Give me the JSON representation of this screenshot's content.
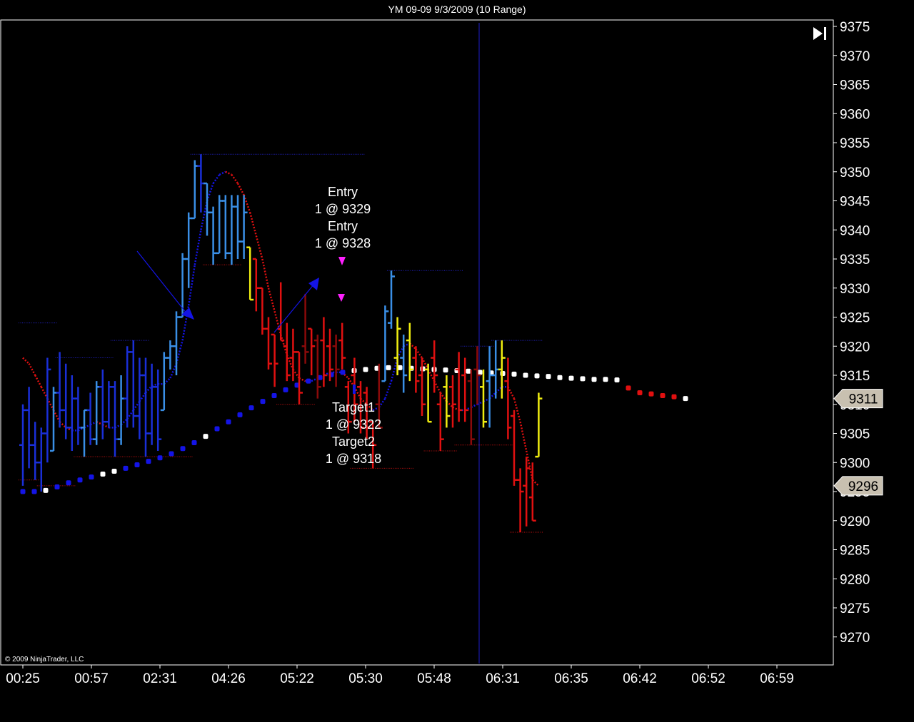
{
  "window": {
    "title": "YM 09-09  9/3/2009 (10 Range)"
  },
  "copyright": "© 2009 NinjaTrader, LLC",
  "colors": {
    "background": "#000000",
    "axis": "#ffffff",
    "bar_up": "#3a8fe6",
    "bar_up_dark": "#1a2fd8",
    "bar_down": "#e01010",
    "bar_down_dark": "#8a0a0a",
    "bar_neutral": "#f0ee10",
    "ma_up": "#1414e6",
    "ma_down": "#e01010",
    "trend_bull": "#1414e6",
    "trend_neutral": "#ffffff",
    "trend_bear": "#e01010",
    "level_high": "#2020c0",
    "level_low": "#c01010",
    "marker": "#ff20ff",
    "cursor_line": "#1c1cc8",
    "price_label": "#c8c0b0"
  },
  "controls": {
    "scroll_end_icon": "skip-to-end-icon"
  },
  "chart_data": {
    "type": "ohlc",
    "y_ticks": [
      9375,
      9370,
      9365,
      9360,
      9355,
      9350,
      9345,
      9340,
      9335,
      9330,
      9325,
      9320,
      9315,
      9310,
      9305,
      9300,
      9295,
      9290,
      9285,
      9280,
      9275,
      9270
    ],
    "ylim": [
      9265,
      9376
    ],
    "x_ticks": [
      "00:25",
      "00:57",
      "02:31",
      "04:26",
      "05:22",
      "05:30",
      "05:48",
      "06:31",
      "06:35",
      "06:42",
      "06:52",
      "06:59"
    ],
    "price_labels": [
      9311,
      9296
    ],
    "annotations": [
      {
        "label": "Entry",
        "value": "1 @ 9329"
      },
      {
        "label": "Entry",
        "value": "1 @ 9328"
      },
      {
        "label": "Target1",
        "value": "1 @ 9322"
      },
      {
        "label": "Target2",
        "value": "1 @ 9318"
      }
    ],
    "bars": [
      {
        "o": 9303,
        "h": 9310,
        "l": 9296,
        "c": 9309,
        "k": "ud"
      },
      {
        "o": 9309,
        "h": 9313,
        "l": 9299,
        "c": 9303,
        "k": "ud"
      },
      {
        "o": 9303,
        "h": 9307,
        "l": 9297,
        "c": 9300,
        "k": "ud"
      },
      {
        "o": 9300,
        "h": 9306,
        "l": 9295,
        "c": 9305,
        "k": "ud"
      },
      {
        "o": 9305,
        "h": 9318,
        "l": 9300,
        "c": 9316,
        "k": "ud"
      },
      {
        "o": 9302,
        "h": 9313,
        "l": 9302,
        "c": 9312,
        "k": "u"
      },
      {
        "o": 9312,
        "h": 9319,
        "l": 9306,
        "c": 9309,
        "k": "ud"
      },
      {
        "o": 9309,
        "h": 9317,
        "l": 9304,
        "c": 9306,
        "k": "ud"
      },
      {
        "o": 9306,
        "h": 9315,
        "l": 9302,
        "c": 9311,
        "k": "ud"
      },
      {
        "o": 9311,
        "h": 9313,
        "l": 9303,
        "c": 9306,
        "k": "ud"
      },
      {
        "o": 9306,
        "h": 9309,
        "l": 9301,
        "c": 9309,
        "k": "u"
      },
      {
        "o": 9309,
        "h": 9312,
        "l": 9303,
        "c": 9304,
        "k": "ud"
      },
      {
        "o": 9304,
        "h": 9314,
        "l": 9303,
        "c": 9313,
        "k": "u"
      },
      {
        "o": 9313,
        "h": 9316,
        "l": 9304,
        "c": 9307,
        "k": "ud"
      },
      {
        "o": 9307,
        "h": 9314,
        "l": 9306,
        "c": 9313,
        "k": "ud"
      },
      {
        "o": 9313,
        "h": 9314,
        "l": 9301,
        "c": 9304,
        "k": "ud"
      },
      {
        "o": 9304,
        "h": 9315,
        "l": 9303,
        "c": 9311,
        "k": "u"
      },
      {
        "o": 9311,
        "h": 9320,
        "l": 9306,
        "c": 9319,
        "k": "ud"
      },
      {
        "o": 9319,
        "h": 9321,
        "l": 9306,
        "c": 9308,
        "k": "ud"
      },
      {
        "o": 9308,
        "h": 9318,
        "l": 9304,
        "c": 9315,
        "k": "ud"
      },
      {
        "o": 9315,
        "h": 9318,
        "l": 9301,
        "c": 9305,
        "k": "ud"
      },
      {
        "o": 9305,
        "h": 9317,
        "l": 9303,
        "c": 9313,
        "k": "ud"
      },
      {
        "o": 9313,
        "h": 9316,
        "l": 9302,
        "c": 9304,
        "k": "ud"
      },
      {
        "o": 9309,
        "h": 9319,
        "l": 9309,
        "c": 9318,
        "k": "u"
      },
      {
        "o": 9318,
        "h": 9321,
        "l": 9316,
        "c": 9320,
        "k": "u"
      },
      {
        "o": 9320,
        "h": 9326,
        "l": 9315,
        "c": 9325,
        "k": "u"
      },
      {
        "o": 9325,
        "h": 9336,
        "l": 9325,
        "c": 9335,
        "k": "u"
      },
      {
        "o": 9335,
        "h": 9343,
        "l": 9330,
        "c": 9342,
        "k": "u"
      },
      {
        "o": 9342,
        "h": 9352,
        "l": 9342,
        "c": 9351,
        "k": "u"
      },
      {
        "o": 9351,
        "h": 9353,
        "l": 9343,
        "c": 9348,
        "k": "ud"
      },
      {
        "o": 9348,
        "h": 9348,
        "l": 9339,
        "c": 9343,
        "k": "u"
      },
      {
        "o": 9343,
        "h": 9344,
        "l": 9334,
        "c": 9336,
        "k": "u"
      },
      {
        "o": 9336,
        "h": 9346,
        "l": 9336,
        "c": 9345,
        "k": "u"
      },
      {
        "o": 9345,
        "h": 9346,
        "l": 9335,
        "c": 9336,
        "k": "u"
      },
      {
        "o": 9336,
        "h": 9346,
        "l": 9334,
        "c": 9344,
        "k": "u"
      },
      {
        "o": 9344,
        "h": 9346,
        "l": 9335,
        "c": 9338,
        "k": "u"
      },
      {
        "o": 9338,
        "h": 9346,
        "l": 9335,
        "c": 9343,
        "k": "u"
      },
      {
        "o": 9337,
        "h": 9337,
        "l": 9328,
        "c": 9328,
        "k": "n"
      },
      {
        "o": 9335,
        "h": 9335,
        "l": 9326,
        "c": 9330,
        "k": "d"
      },
      {
        "o": 9330,
        "h": 9330,
        "l": 9322,
        "c": 9323,
        "k": "d"
      },
      {
        "o": 9323,
        "h": 9325,
        "l": 9316,
        "c": 9317,
        "k": "d"
      },
      {
        "o": 9322,
        "h": 9322,
        "l": 9313,
        "c": 9317,
        "k": "d"
      },
      {
        "o": 9323,
        "h": 9331,
        "l": 9321,
        "c": 9321,
        "k": "d"
      },
      {
        "o": 9320,
        "h": 9324,
        "l": 9314,
        "c": 9315,
        "k": "d"
      },
      {
        "o": 9318,
        "h": 9323,
        "l": 9314,
        "c": 9319,
        "k": "d"
      },
      {
        "o": 9319,
        "h": 9319,
        "l": 9310,
        "c": 9312,
        "k": "d"
      },
      {
        "o": 9320,
        "h": 9329,
        "l": 9317,
        "c": 9319,
        "k": "dd"
      },
      {
        "o": 9323,
        "h": 9323,
        "l": 9315,
        "c": 9320,
        "k": "d"
      },
      {
        "o": 9321,
        "h": 9322,
        "l": 9311,
        "c": 9313,
        "k": "dd"
      },
      {
        "o": 9321,
        "h": 9325,
        "l": 9313,
        "c": 9315,
        "k": "d"
      },
      {
        "o": 9320,
        "h": 9323,
        "l": 9314,
        "c": 9316,
        "k": "d"
      },
      {
        "o": 9320,
        "h": 9322,
        "l": 9313,
        "c": 9316,
        "k": "dd"
      },
      {
        "o": 9321,
        "h": 9324,
        "l": 9316,
        "c": 9318,
        "k": "d"
      },
      {
        "o": 9313,
        "h": 9314,
        "l": 9305,
        "c": 9307,
        "k": "d"
      },
      {
        "o": 9315,
        "h": 9318,
        "l": 9307,
        "c": 9310,
        "k": "d"
      },
      {
        "o": 9313,
        "h": 9314,
        "l": 9305,
        "c": 9306,
        "k": "d"
      },
      {
        "o": 9312,
        "h": 9313,
        "l": 9304,
        "c": 9306,
        "k": "d"
      },
      {
        "o": 9307,
        "h": 9307,
        "l": 9299,
        "c": 9303,
        "k": "d"
      },
      {
        "o": 9310,
        "h": 9317,
        "l": 9306,
        "c": 9306,
        "k": "dd"
      },
      {
        "o": 9314,
        "h": 9327,
        "l": 9314,
        "c": 9326,
        "k": "u"
      },
      {
        "o": 9324,
        "h": 9333,
        "l": 9323,
        "c": 9332,
        "k": "u"
      },
      {
        "o": 9318,
        "h": 9325,
        "l": 9315,
        "c": 9323,
        "k": "n"
      },
      {
        "o": 9318,
        "h": 9322,
        "l": 9312,
        "c": 9315,
        "k": "u"
      },
      {
        "o": 9321,
        "h": 9324,
        "l": 9314,
        "c": 9316,
        "k": "n"
      },
      {
        "o": 9318,
        "h": 9320,
        "l": 9312,
        "c": 9314,
        "k": "d"
      },
      {
        "o": 9315,
        "h": 9318,
        "l": 9308,
        "c": 9310,
        "k": "d"
      },
      {
        "o": 9316,
        "h": 9317,
        "l": 9307,
        "c": 9307,
        "k": "n"
      },
      {
        "o": 9318,
        "h": 9321,
        "l": 9312,
        "c": 9315,
        "k": "d"
      },
      {
        "o": 9310,
        "h": 9312,
        "l": 9302,
        "c": 9304,
        "k": "d"
      },
      {
        "o": 9313,
        "h": 9315,
        "l": 9306,
        "c": 9308,
        "k": "n"
      },
      {
        "o": 9313,
        "h": 9315,
        "l": 9306,
        "c": 9310,
        "k": "d"
      },
      {
        "o": 9316,
        "h": 9319,
        "l": 9307,
        "c": 9309,
        "k": "d"
      },
      {
        "o": 9315,
        "h": 9318,
        "l": 9307,
        "c": 9309,
        "k": "d"
      },
      {
        "o": 9314,
        "h": 9316,
        "l": 9303,
        "c": 9304,
        "k": "dd"
      },
      {
        "o": 9316,
        "h": 9320,
        "l": 9310,
        "c": 9315,
        "k": "dd"
      },
      {
        "o": 9313,
        "h": 9316,
        "l": 9306,
        "c": 9307,
        "k": "n"
      },
      {
        "o": 9314,
        "h": 9320,
        "l": 9306,
        "c": 9315,
        "k": "u"
      },
      {
        "o": 9315,
        "h": 9321,
        "l": 9311,
        "c": 9316,
        "k": "u"
      },
      {
        "o": 9316,
        "h": 9321,
        "l": 9311,
        "c": 9318,
        "k": "n"
      },
      {
        "o": 9314,
        "h": 9318,
        "l": 9304,
        "c": 9306,
        "k": "d"
      },
      {
        "o": 9308,
        "h": 9309,
        "l": 9296,
        "c": 9297,
        "k": "d"
      },
      {
        "o": 9297,
        "h": 9299,
        "l": 9288,
        "c": 9295,
        "k": "d"
      },
      {
        "o": 9296,
        "h": 9301,
        "l": 9289,
        "c": 9299,
        "k": "d"
      },
      {
        "o": 9294,
        "h": 9300,
        "l": 9290,
        "c": 9290,
        "k": "d"
      },
      {
        "o": 9301,
        "h": 9312,
        "l": 9301,
        "c": 9311,
        "k": "n"
      }
    ],
    "ma": [
      9318,
      9317,
      9315,
      9313,
      9311,
      9309,
      9307,
      9306,
      9305.5,
      9305.5,
      9306,
      9306.5,
      9307,
      9306.5,
      9306,
      9306,
      9306.5,
      9307.5,
      9309,
      9310.5,
      9312,
      9313.2,
      9313.5,
      9313.5,
      9314.5,
      9317,
      9321,
      9327,
      9334,
      9340,
      9345,
      9348,
      9349.5,
      9350,
      9349.5,
      9348,
      9346,
      9343,
      9339,
      9335,
      9330,
      9326,
      9322,
      9318.5,
      9316,
      9314.5,
      9314,
      9314,
      9314.5,
      9315,
      9315.5,
      9315.5,
      9315.5,
      9314.5,
      9313,
      9311,
      9310,
      9309,
      9309.5,
      9311,
      9314,
      9318,
      9320,
      9320.5,
      9319.5,
      9318,
      9316,
      9314,
      9312,
      9310.5,
      9309.5,
      9309,
      9309,
      9309.5,
      9310,
      9310.5,
      9311,
      9312,
      9313,
      9313,
      9311,
      9307,
      9302,
      9297,
      9296
    ],
    "trend": [
      9295,
      9295,
      9295.2,
      9295.8,
      9296.5,
      9297,
      9297.5,
      9298,
      9298.5,
      9299,
      9299.6,
      9300.2,
      9300.8,
      9301.5,
      9302.4,
      9303.4,
      9304.5,
      9305.8,
      9307,
      9308.2,
      9309.4,
      9310.5,
      9311.5,
      9312.5,
      9313.3,
      9314,
      9314.6,
      9315.1,
      9315.5,
      9315.8,
      9316,
      9316.2,
      9316.3,
      9316.3,
      9316.2,
      9316.1,
      9316,
      9315.9,
      9315.8,
      9315.7,
      9315.5,
      9315.4,
      9315.3,
      9315.2,
      9315,
      9314.9,
      9314.8,
      9314.6,
      9314.5,
      9314.4,
      9314.3,
      9314.3,
      9314.2,
      9312.8,
      9312,
      9311.8,
      9311.5,
      9311.3,
      9311
    ],
    "trend_colors": [
      "bull",
      "bull",
      "neutral",
      "bull",
      "bull",
      "bull",
      "bull",
      "neutral",
      "neutral",
      "bull",
      "bull",
      "bull",
      "bull",
      "bull",
      "bull",
      "bull",
      "neutral",
      "bull",
      "bull",
      "bull",
      "bull",
      "bull",
      "bull",
      "bull",
      "bull",
      "bull",
      "bull",
      "bull",
      "bull",
      "neutral",
      "neutral",
      "neutral",
      "neutral",
      "neutral",
      "neutral",
      "neutral",
      "neutral",
      "neutral",
      "neutral",
      "neutral",
      "neutral",
      "neutral",
      "neutral",
      "neutral",
      "neutral",
      "neutral",
      "neutral",
      "neutral",
      "neutral",
      "neutral",
      "neutral",
      "neutral",
      "neutral",
      "bear",
      "bear",
      "bear",
      "bear",
      "bear",
      "neutral"
    ],
    "levels": [
      {
        "v": 9324,
        "x0": 0,
        "x1": 5,
        "t": "high"
      },
      {
        "v": 9318,
        "x0": 6,
        "x1": 14,
        "t": "high"
      },
      {
        "v": 9321,
        "x0": 15,
        "x1": 20,
        "t": "high"
      },
      {
        "v": 9353,
        "x0": 28,
        "x1": 55,
        "t": "high"
      },
      {
        "v": 9333,
        "x0": 60,
        "x1": 71,
        "t": "high"
      },
      {
        "v": 9320,
        "x0": 72,
        "x1": 76,
        "t": "high"
      },
      {
        "v": 9321,
        "x0": 77,
        "x1": 84,
        "t": "high"
      },
      {
        "v": 9297,
        "x0": 0,
        "x1": 2,
        "t": "low"
      },
      {
        "v": 9296,
        "x0": 3,
        "x1": 8,
        "t": "low"
      },
      {
        "v": 9301,
        "x0": 9,
        "x1": 27,
        "t": "low"
      },
      {
        "v": 9334,
        "x0": 30,
        "x1": 35,
        "t": "low"
      },
      {
        "v": 9310,
        "x0": 42,
        "x1": 47,
        "t": "low"
      },
      {
        "v": 9299,
        "x0": 54,
        "x1": 63,
        "t": "low"
      },
      {
        "v": 9302,
        "x0": 66,
        "x1": 70,
        "t": "low"
      },
      {
        "v": 9303,
        "x0": 71,
        "x1": 79,
        "t": "low"
      },
      {
        "v": 9288,
        "x0": 80,
        "x1": 84,
        "t": "low"
      }
    ]
  }
}
